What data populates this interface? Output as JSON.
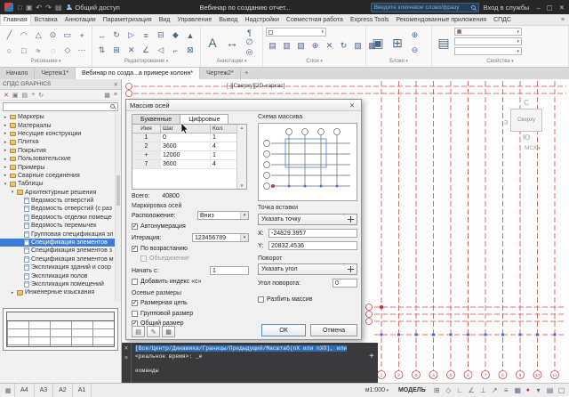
{
  "icons": {
    "close": "✕",
    "minimize": "–",
    "maximize": "▢",
    "menu": "≡",
    "plus": "+",
    "record": "●"
  },
  "titlebar": {
    "share": "Общий доступ",
    "title": "Вебинар по созданию отчет...",
    "search_placeholder": "Введите ключевое слово/фразу",
    "login": "Вход в службы",
    "qat": [
      {
        "glyph": "□"
      },
      {
        "glyph": "▣"
      },
      {
        "glyph": "↶"
      },
      {
        "glyph": "↷"
      },
      {
        "glyph": "▤"
      }
    ]
  },
  "ribbon": {
    "tabs": [
      {
        "label": "Главная",
        "active": true
      },
      {
        "label": "Вставка"
      },
      {
        "label": "Аннотации"
      },
      {
        "label": "Параметризация"
      },
      {
        "label": "Вид"
      },
      {
        "label": "Управление"
      },
      {
        "label": "Вывод"
      },
      {
        "label": "Надстройки"
      },
      {
        "label": "Совместная работа"
      },
      {
        "label": "Express Tools"
      },
      {
        "label": "Рекомендованные приложения"
      },
      {
        "label": "СПДС"
      }
    ],
    "groups": [
      {
        "label": "Рисование",
        "icons": [
          "╱",
          "○",
          "◠",
          "□",
          "△",
          "≈",
          "⊙",
          "◌",
          "▭",
          "◇",
          "+",
          "⋯"
        ]
      },
      {
        "label": "Редактирование",
        "icons": [
          "↔",
          "⇅",
          "↻",
          "⊞",
          "▷",
          "✕",
          "≡",
          "∠",
          "⊟",
          "◁",
          "◆",
          "⌐",
          "▲",
          "⊠"
        ]
      },
      {
        "label": "Аннотации",
        "big": [
          "A",
          "↔"
        ],
        "icons": [
          "¶",
          "∅",
          "◎"
        ]
      },
      {
        "label": "Слои",
        "icons": [
          "▤",
          "▥",
          "▧",
          "⊕",
          "✕",
          "↻",
          "▨",
          "▩"
        ]
      },
      {
        "label": "Блоки",
        "big": [
          "▣",
          "⊞"
        ],
        "icons": [
          "⊕",
          "⊖"
        ]
      },
      {
        "label": "Свойства",
        "big": [
          "▤"
        ]
      }
    ]
  },
  "doc_tabs": [
    {
      "label": "Начало"
    },
    {
      "label": "Чертеж1*"
    },
    {
      "label": "Вебинар по созда...а примере колонн*",
      "active": true
    },
    {
      "label": "Чертеж2*"
    }
  ],
  "palette": {
    "title": "СПДС GRAPHICS",
    "tools": [
      {
        "glyph": "✕",
        "red": true
      },
      {
        "glyph": "▣"
      },
      {
        "glyph": "▤"
      },
      {
        "glyph": "+"
      },
      {
        "glyph": "↻"
      }
    ],
    "tools_right": [
      {
        "glyph": "▦"
      },
      {
        "glyph": "≡"
      }
    ],
    "tree": [
      {
        "label": "Маркеры",
        "indent": 0,
        "folder": true
      },
      {
        "label": "Материалы",
        "indent": 0,
        "folder": true
      },
      {
        "label": "Несущие конструкции",
        "indent": 0,
        "folder": true
      },
      {
        "label": "Плитка",
        "indent": 0,
        "folder": true
      },
      {
        "label": "Покрытия",
        "indent": 0,
        "folder": true
      },
      {
        "label": "Пользовательские",
        "indent": 0,
        "folder": true
      },
      {
        "label": "Примеры",
        "indent": 0,
        "folder": true
      },
      {
        "label": "Сварные соединения",
        "indent": 0,
        "folder": true
      },
      {
        "label": "Таблицы",
        "indent": 0,
        "folder": true,
        "expanded": true
      },
      {
        "label": "Архитектурные решения",
        "indent": 1,
        "folder": true,
        "expanded": true
      },
      {
        "label": "Ведомость отверстий",
        "indent": 2
      },
      {
        "label": "Ведомость отверстий (с раз",
        "indent": 2
      },
      {
        "label": "Ведомость отделки помеще",
        "indent": 2
      },
      {
        "label": "Ведомость перемычек",
        "indent": 2
      },
      {
        "label": "Групповая спецификация эл",
        "indent": 2
      },
      {
        "label": "Спецификация элементов",
        "indent": 2,
        "selected": true
      },
      {
        "label": "Спецификация элементов з",
        "indent": 2
      },
      {
        "label": "Спецификация элементов м",
        "indent": 2
      },
      {
        "label": "Экспликация зданий и соор",
        "indent": 2
      },
      {
        "label": "Экспликация полов",
        "indent": 2
      },
      {
        "label": "Экспликация помещений",
        "indent": 2
      },
      {
        "label": "Инженерные изыскания",
        "indent": 1,
        "folder": true
      }
    ]
  },
  "viewport": {
    "controls": "[-][Сверху][2D-каркас]",
    "north": "С",
    "west": "З",
    "south": "Ю",
    "cube": "Сверху",
    "ucs": "МСК",
    "axis_numbers": [
      "1",
      "2",
      "3",
      "4",
      "5",
      "6",
      "7",
      "8",
      "9",
      "10",
      "11"
    ]
  },
  "dialog": {
    "title": "Массив осей",
    "tabs": [
      {
        "label": "Буквенные"
      },
      {
        "label": "Цифровые",
        "active": true
      }
    ],
    "grid": {
      "headers": [
        "Имя",
        "Шаг",
        "Кол."
      ],
      "rows": [
        {
          "name": "1",
          "step": "0",
          "count": "1"
        },
        {
          "name": "2",
          "step": "3600",
          "count": "4"
        },
        {
          "name": "+",
          "step": "12000",
          "count": "1"
        },
        {
          "name": "7",
          "step": "3600",
          "count": "4"
        }
      ]
    },
    "total_label": "Всего:",
    "total_value": "40800",
    "marking_title": "Маркировка осей",
    "location_label": "Расположение:",
    "location_value": "Вниз",
    "autonumber_label": "Автонумерация",
    "autonumber_checked": true,
    "iteration_label": "Итерация:",
    "iteration_value": "123456789",
    "ascending_label": "По возрастанию",
    "ascending_checked": true,
    "merge_label": "Объединение",
    "merge_checked": false,
    "start_label": "Начать с:",
    "start_value": "1",
    "index_label": "Добавить индекс «с»",
    "index_checked": false,
    "scheme_label": "Схема массива",
    "insert_title": "Точка вставки",
    "pick_point": "Указать точку",
    "x_label": "X:",
    "x_value": "-24829.3957",
    "y_label": "Y:",
    "y_value": "20832.4536",
    "rotate_title": "Поворот",
    "pick_angle": "Указать угол",
    "angle_label": "Угол поворота:",
    "angle_value": "0",
    "explode_label": "Разбить массив",
    "explode_checked": false,
    "dims_title": "Осевые размеры",
    "dims": [
      {
        "label": "Размерная цепь",
        "checked": true
      },
      {
        "label": "Групповой размер",
        "checked": false
      },
      {
        "label": "Общий размер",
        "checked": true
      }
    ],
    "ok": "ОК",
    "cancel": "Отмена"
  },
  "command": {
    "line1": "[Все/Центр/Динамика/Границы/Предыдущий/Масштаб(nX или nXП), или",
    "line2": "<реальное время>: _e",
    "prompt": "команды"
  },
  "statusbar": {
    "sheets": [
      "А4",
      "А3",
      "А2",
      "А1"
    ],
    "scale": "м1:000",
    "space": "МОДЕЛЬ",
    "toggles": [
      {
        "glyph": "⊞"
      },
      {
        "glyph": "◇"
      },
      {
        "glyph": "∟"
      },
      {
        "glyph": "∠"
      },
      {
        "glyph": "⊥"
      },
      {
        "glyph": "↗"
      },
      {
        "glyph": "≡"
      },
      {
        "glyph": "▦"
      }
    ],
    "end_icons": [
      {
        "glyph": "▾"
      },
      {
        "glyph": "▤"
      },
      {
        "glyph": "▢"
      }
    ]
  }
}
